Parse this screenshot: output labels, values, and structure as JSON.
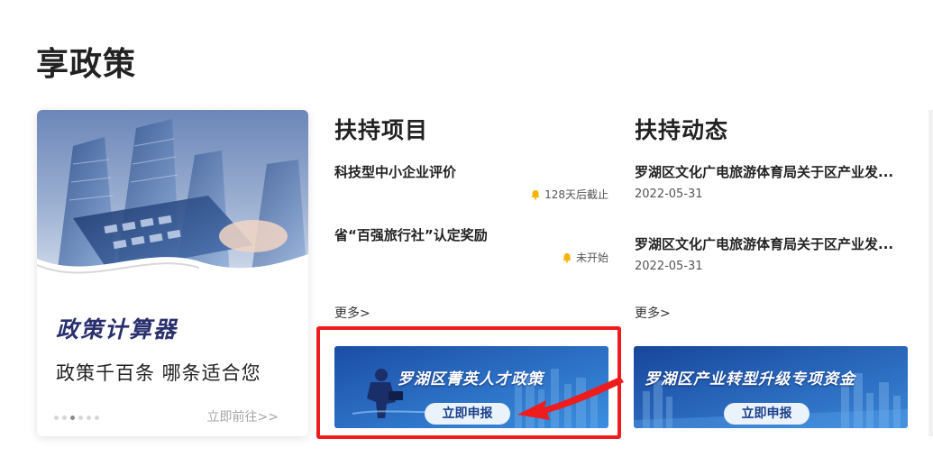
{
  "section_title": "享政策",
  "calculator": {
    "title": "政策计算器",
    "subtitle": "政策千百条 哪条适合您",
    "goto_label": "立即前往>>",
    "carousel_dots": 6,
    "active_dot": 2
  },
  "support_projects": {
    "title": "扶持项目",
    "items": [
      {
        "title": "科技型中小企业评价",
        "status": "128天后截止"
      },
      {
        "title": "省“百强旅行社”认定奖励",
        "status": "未开始"
      }
    ],
    "more_label": "更多>",
    "banner": {
      "text": "罗湖区菁英人才政策",
      "button_label": "立即申报"
    }
  },
  "support_news": {
    "title": "扶持动态",
    "items": [
      {
        "title": "罗湖区文化广电旅游体育局关于区产业发...",
        "date": "2022-05-31"
      },
      {
        "title": "罗湖区文化广电旅游体育局关于区产业发...",
        "date": "2022-05-31"
      }
    ],
    "more_label": "更多>",
    "banner": {
      "text": "罗湖区产业转型升级专项资金",
      "button_label": "立即申报"
    }
  },
  "colors": {
    "highlight": "#ee1c1c",
    "banner_blue": "#1f5fb8",
    "bell": "#f5b400",
    "calc_title": "#2a2f6e"
  },
  "icons": [
    "bell-icon",
    "arrow-annotation"
  ]
}
